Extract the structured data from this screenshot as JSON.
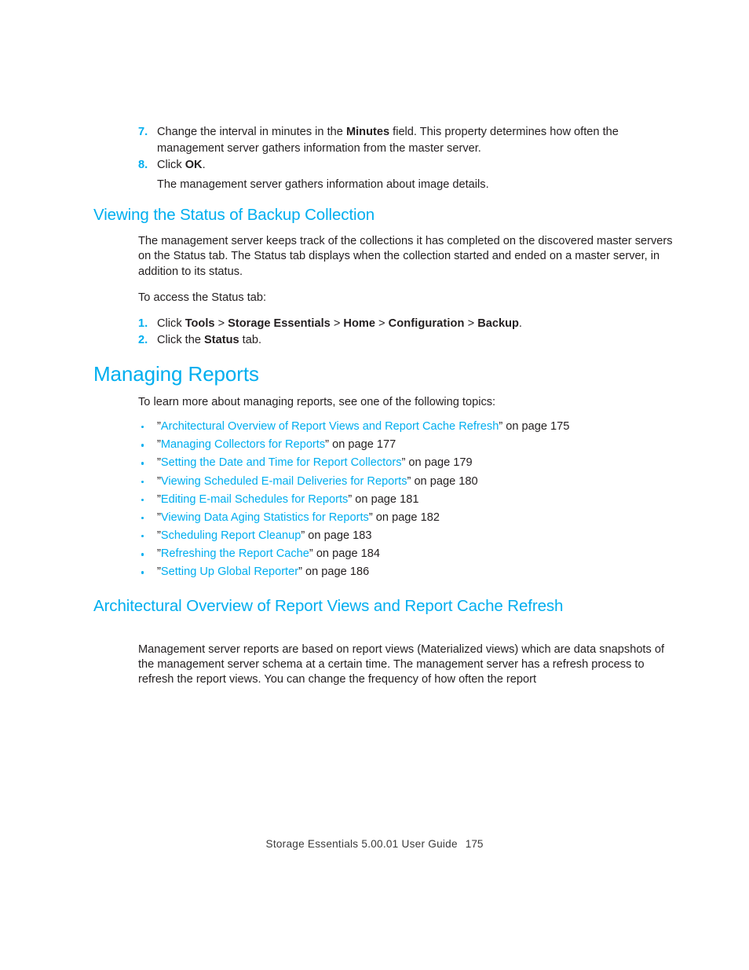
{
  "document": {
    "footer_text": "Storage Essentials 5.00.01 User Guide",
    "footer_page": "175"
  },
  "colors": {
    "accent": "#00aeef",
    "body_text": "#231f20",
    "page_background": "#ffffff"
  },
  "procedure_backup": {
    "steps": [
      {
        "number": "7.",
        "pre": "Change the interval in minutes in the ",
        "bold": "Minutes",
        "post": " field. This property determines how often the management server gathers information from the master server."
      },
      {
        "number": "8.",
        "pre": "Click ",
        "bold": "OK",
        "post": "."
      }
    ],
    "result_text": "The management server gathers information about image details."
  },
  "section_status": {
    "heading": "Viewing the Status of Backup Collection",
    "paragraph": "The management server keeps track of the collections it has completed on the discovered master servers on the Status tab. The Status tab displays when the collection started and ended on a master server, in addition to its status.",
    "lead_in": "To access the Status tab:",
    "steps": [
      {
        "number": "1.",
        "segments": [
          {
            "text": "Click ",
            "style": "plain"
          },
          {
            "text": "Tools",
            "style": "bold"
          },
          {
            "text": " > ",
            "style": "plain"
          },
          {
            "text": "Storage Essentials",
            "style": "bold"
          },
          {
            "text": " > ",
            "style": "plain"
          },
          {
            "text": "Home",
            "style": "bold"
          },
          {
            "text": " > ",
            "style": "plain"
          },
          {
            "text": "Configuration",
            "style": "bold-wide"
          },
          {
            "text": " > ",
            "style": "plain"
          },
          {
            "text": "Backup",
            "style": "bold"
          },
          {
            "text": ".",
            "style": "plain"
          }
        ]
      },
      {
        "number": "2.",
        "segments": [
          {
            "text": "Click the ",
            "style": "plain"
          },
          {
            "text": "Status",
            "style": "bold"
          },
          {
            "text": " tab.",
            "style": "plain"
          }
        ]
      }
    ]
  },
  "section_managing_reports": {
    "heading": "Managing Reports",
    "lead_in": "To learn more about managing reports, see one of the following topics:",
    "links": [
      {
        "title": "Architectural Overview of Report Views and Report Cache Refresh",
        "page_ref": "on page 175"
      },
      {
        "title": "Managing Collectors for Reports",
        "page_ref": "on page 177"
      },
      {
        "title": "Setting the Date and Time for Report Collectors",
        "page_ref": "on page 179"
      },
      {
        "title": "Viewing Scheduled E-mail Deliveries for Reports",
        "page_ref": "on page 180"
      },
      {
        "title": "Editing E-mail Schedules for Reports",
        "page_ref": "on page 181"
      },
      {
        "title": "Viewing Data Aging Statistics for Reports",
        "page_ref": "on page 182"
      },
      {
        "title": "Scheduling Report Cleanup",
        "page_ref": "on page 183"
      },
      {
        "title": "Refreshing the Report Cache",
        "page_ref": "on page 184"
      },
      {
        "title": "Setting Up Global Reporter",
        "page_ref": "on page 186"
      }
    ],
    "quote_open": "”",
    "quote_close": "”"
  },
  "section_architectural": {
    "heading": "Architectural Overview of Report Views and Report Cache Refresh",
    "paragraph": "Management server reports are based on report views (Materialized views) which are data snapshots of the management server schema at a certain time. The management server has a refresh process to refresh the report views. You can change the frequency of how often the report"
  }
}
